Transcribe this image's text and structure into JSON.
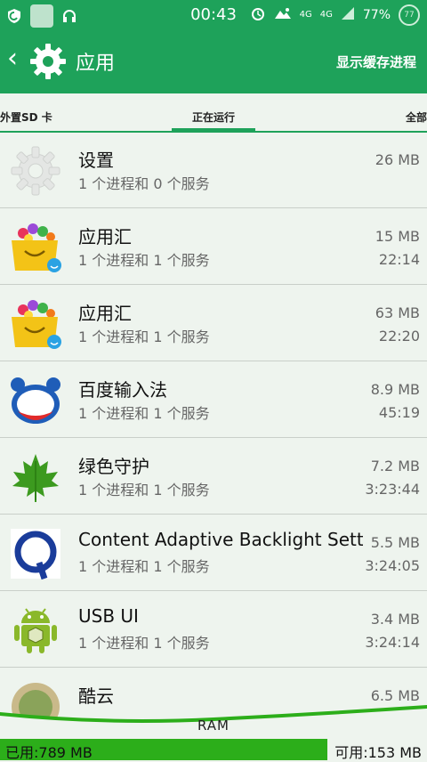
{
  "statusbar": {
    "time": "00:43",
    "battery": "77%",
    "net1": "4G",
    "net2": "4G"
  },
  "header": {
    "title": "应用",
    "action": "显示缓存进程"
  },
  "tabs": {
    "left": "外置SD 卡",
    "active": "正在运行",
    "right": "全部"
  },
  "apps": [
    {
      "name": "设置",
      "sub": "1 个进程和 0 个服务",
      "size": "26 MB",
      "time": ""
    },
    {
      "name": "应用汇",
      "sub": "1 个进程和 1 个服务",
      "size": "15 MB",
      "time": "22:14"
    },
    {
      "name": "应用汇",
      "sub": "1 个进程和 1 个服务",
      "size": "63 MB",
      "time": "22:20"
    },
    {
      "name": "百度输入法",
      "sub": "1 个进程和 1 个服务",
      "size": "8.9 MB",
      "time": "45:19"
    },
    {
      "name": "绿色守护",
      "sub": "1 个进程和 1 个服务",
      "size": "7.2 MB",
      "time": "3:23:44"
    },
    {
      "name": "Content Adaptive Backlight Settings",
      "sub": "1 个进程和 1 个服务",
      "size": "5.5 MB",
      "time": "3:24:05"
    },
    {
      "name": "USB UI",
      "sub": "1 个进程和 1 个服务",
      "size": "3.4 MB",
      "time": "3:24:14"
    },
    {
      "name": "酷云",
      "sub": "",
      "size": "6.5 MB",
      "time": ""
    }
  ],
  "ram": {
    "label": "RAM",
    "used": "已用:789 MB",
    "free": "可用:153 MB"
  },
  "colors": {
    "accent": "#1ea25a",
    "ram_bar": "#2cae1a"
  }
}
